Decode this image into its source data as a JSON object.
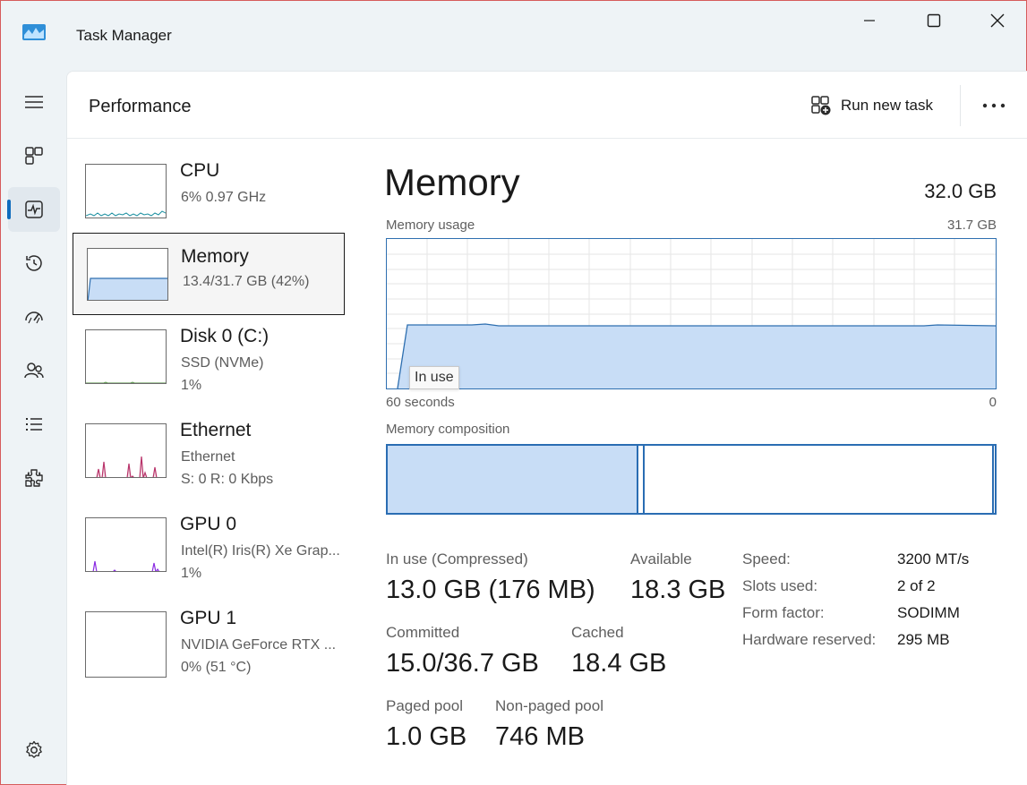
{
  "window": {
    "title": "Task Manager",
    "icon": "task-manager-icon"
  },
  "nav": {
    "items": [
      {
        "name": "hamburger-menu-icon",
        "active": false
      },
      {
        "name": "processes-icon",
        "active": false
      },
      {
        "name": "performance-icon",
        "active": true
      },
      {
        "name": "app-history-icon",
        "active": false
      },
      {
        "name": "startup-apps-icon",
        "active": false
      },
      {
        "name": "users-icon",
        "active": false
      },
      {
        "name": "details-icon",
        "active": false
      },
      {
        "name": "services-icon",
        "active": false
      }
    ],
    "settings_icon": "gear-icon"
  },
  "header": {
    "title": "Performance",
    "run_new_task_label": "Run new task",
    "more_icon": "more-icon"
  },
  "devices": [
    {
      "name": "CPU",
      "sub1": "6%  0.97 GHz",
      "sub2": ""
    },
    {
      "name": "Memory",
      "sub1": "13.4/31.7 GB (42%)",
      "sub2": ""
    },
    {
      "name": "Disk 0 (C:)",
      "sub1": "SSD (NVMe)",
      "sub2": "1%"
    },
    {
      "name": "Ethernet",
      "sub1": "Ethernet",
      "sub2": "S: 0  R: 0 Kbps"
    },
    {
      "name": "GPU 0",
      "sub1": "Intel(R) Iris(R) Xe Grap...",
      "sub2": "1%"
    },
    {
      "name": "GPU 1",
      "sub1": "NVIDIA GeForce RTX ...",
      "sub2": "0%  (51 °C)"
    }
  ],
  "detail": {
    "title": "Memory",
    "total": "32.0 GB",
    "usage_label": "Memory usage",
    "usage_max": "31.7 GB",
    "time_left": "60 seconds",
    "time_right": "0",
    "tooltip": "In use",
    "composition_label": "Memory composition",
    "stats": {
      "in_use_label": "In use (Compressed)",
      "in_use_value": "13.0 GB (176 MB)",
      "available_label": "Available",
      "available_value": "18.3 GB",
      "committed_label": "Committed",
      "committed_value": "15.0/36.7 GB",
      "cached_label": "Cached",
      "cached_value": "18.4 GB",
      "paged_label": "Paged pool",
      "paged_value": "1.0 GB",
      "nonpaged_label": "Non-paged pool",
      "nonpaged_value": "746 MB"
    },
    "specs": [
      {
        "key": "Speed:",
        "value": "3200 MT/s"
      },
      {
        "key": "Slots used:",
        "value": "2 of 2"
      },
      {
        "key": "Form factor:",
        "value": "SODIMM"
      },
      {
        "key": "Hardware reserved:",
        "value": "295 MB"
      }
    ]
  },
  "colors": {
    "accent": "#0f6cbd",
    "memory_line": "#2e6fb0",
    "memory_fill": "#c8ddf6",
    "cpu_line": "#1a8fa0",
    "ethernet_line": "#b8336a",
    "gpu_line": "#8a2be2",
    "disk_line": "#4a8a3a"
  }
}
